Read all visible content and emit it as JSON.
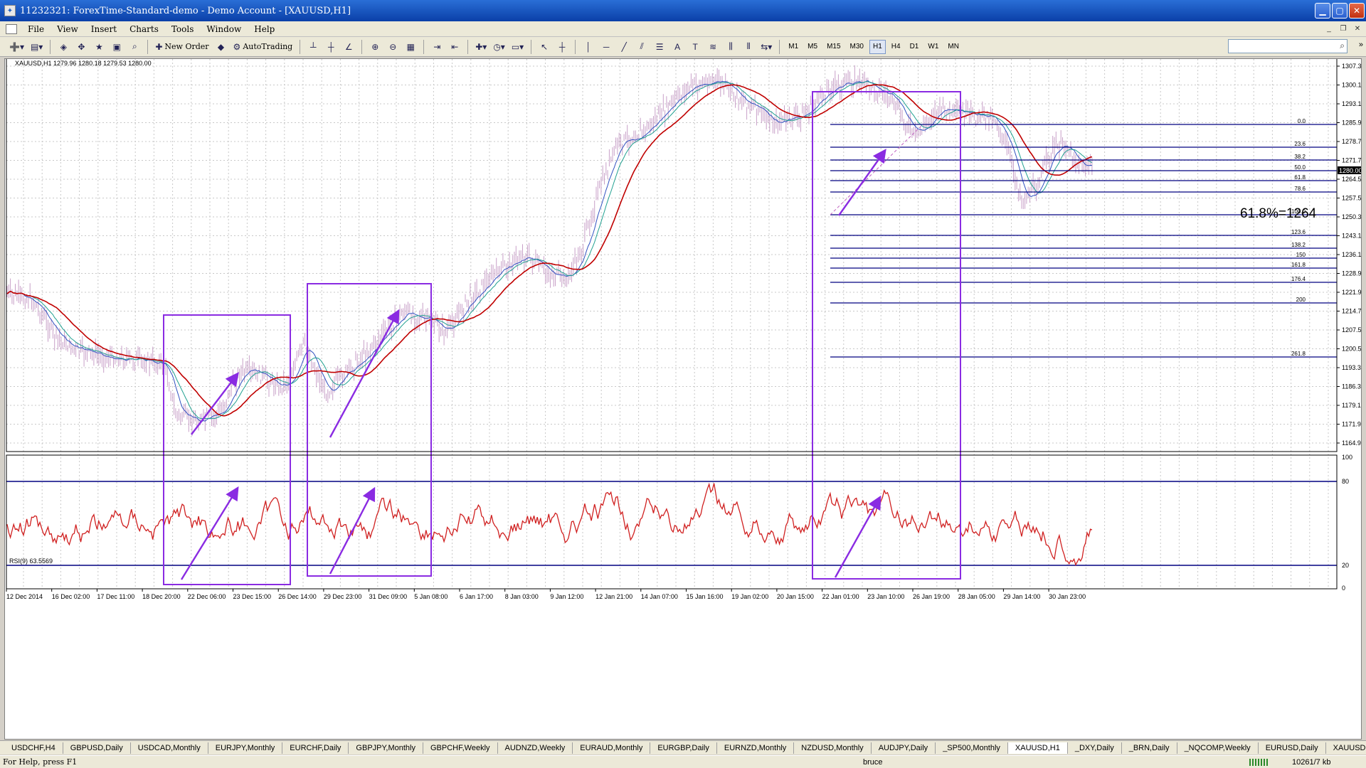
{
  "window": {
    "title": "11232321: ForexTime-Standard-demo - Demo Account - [XAUUSD,H1]"
  },
  "menu": [
    "File",
    "View",
    "Insert",
    "Charts",
    "Tools",
    "Window",
    "Help"
  ],
  "toolbar": {
    "new_order": "New Order",
    "auto_trading": "AutoTrading",
    "timeframes": [
      "M1",
      "M5",
      "M15",
      "M30",
      "H1",
      "H4",
      "D1",
      "W1",
      "MN"
    ],
    "active_timeframe": "H1",
    "search_placeholder": ""
  },
  "chart": {
    "header": "XAUUSD,H1  1279.96 1280.18 1279.53 1280.00",
    "price_axis": [
      "1307.30",
      "1300.10",
      "1293.10",
      "1285.90",
      "1278.70",
      "1271.70",
      "1264.50",
      "1257.50",
      "1250.30",
      "1243.10",
      "1236.10",
      "1228.90",
      "1221.90",
      "1214.70",
      "1207.50",
      "1200.50",
      "1193.30",
      "1186.30",
      "1179.10",
      "1171.90",
      "1164.90"
    ],
    "current_price": "1280.00",
    "time_axis": [
      "12 Dec 2014",
      "16 Dec 02:00",
      "17 Dec 11:00",
      "18 Dec 20:00",
      "22 Dec 06:00",
      "23 Dec 15:00",
      "26 Dec 14:00",
      "29 Dec 23:00",
      "31 Dec 09:00",
      "5 Jan 08:00",
      "6 Jan 17:00",
      "8 Jan 03:00",
      "9 Jan 12:00",
      "12 Jan 21:00",
      "14 Jan 07:00",
      "15 Jan 16:00",
      "19 Jan 02:00",
      "20 Jan 15:00",
      "22 Jan 01:00",
      "23 Jan 10:00",
      "26 Jan 19:00",
      "28 Jan 05:00",
      "29 Jan 14:00",
      "30 Jan 23:00"
    ],
    "fib_levels": [
      "0.0",
      "23.6",
      "38.2",
      "50.0",
      "61.8",
      "78.6",
      "100.0",
      "123.6",
      "138.2",
      "150",
      "161.8",
      "176.4",
      "200",
      "261.8"
    ],
    "fib_annotation": "61.8%=1264",
    "rsi_label": "RSI(9) 63.5569",
    "rsi_axis": [
      "100",
      "80",
      "20",
      "0"
    ],
    "colors": {
      "candles": "#c8a0c8",
      "ma_slow": "#c00000",
      "ma_mid": "#20a090",
      "ma_fast": "#3050c0",
      "annotation": "#8a2be2",
      "fib": "#000080",
      "rsi": "#d02020"
    }
  },
  "tabs": [
    "USDCHF,H4",
    "GBPUSD,Daily",
    "USDCAD,Monthly",
    "EURJPY,Monthly",
    "EURCHF,Daily",
    "GBPJPY,Monthly",
    "GBPCHF,Weekly",
    "AUDNZD,Weekly",
    "EURAUD,Monthly",
    "EURGBP,Daily",
    "EURNZD,Monthly",
    "NZDUSD,Monthly",
    "AUDJPY,Daily",
    "_SP500,Monthly",
    "XAUUSD,H1",
    "_DXY,Daily",
    "_BRN,Daily",
    "_NQCOMP,Weekly",
    "EURUSD,Daily",
    "XAUUSD,Weekly"
  ],
  "active_tab": "XAUUSD,H1",
  "status": {
    "help": "For Help, press F1",
    "user": "bruce",
    "traffic": "10261/7 kb"
  }
}
